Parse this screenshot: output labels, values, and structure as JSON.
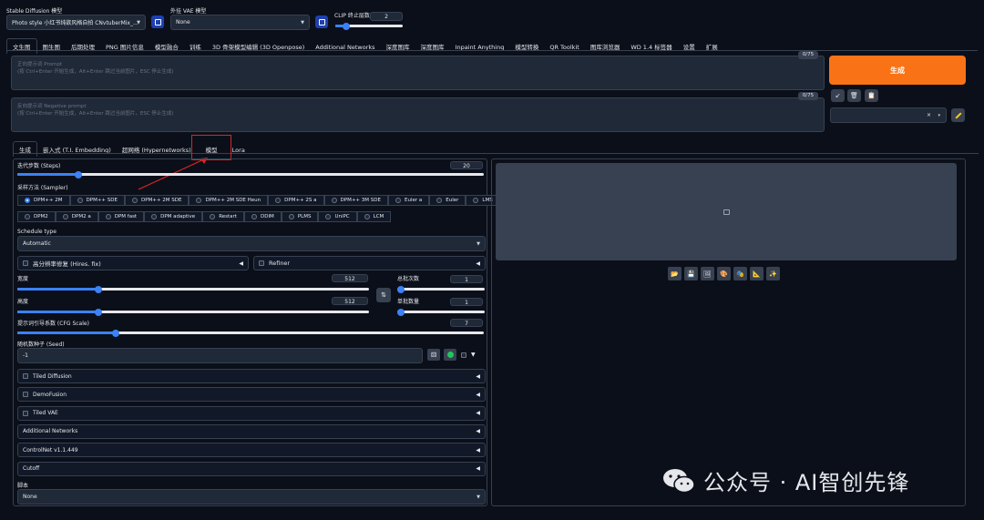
{
  "top": {
    "model_label": "Stable Diffusion 模型",
    "model_value": "Photo style 小红书纯欲风格自拍 CNvtuberMix_...",
    "vae_label": "外挂 VAE 模型",
    "vae_value": "None",
    "clip_label": "CLIP 终止层数",
    "clip_value": "2"
  },
  "main_tabs": [
    "文生图",
    "图生图",
    "后期处理",
    "PNG 图片信息",
    "模型融合",
    "训练",
    "3D 骨架模型编辑 (3D Openpose)",
    "Additional Networks",
    "深度图库",
    "深度图库",
    "Inpaint Anything",
    "模型转换",
    "QR Toolkit",
    "图库浏览器",
    "WD 1.4 标签器",
    "设置",
    "扩展"
  ],
  "prompt": {
    "placeholder_title": "正向提示词 Prompt",
    "placeholder_hint": "(按 Ctrl+Enter 开始生成，Alt+Enter 跳过当前图片，ESC 停止生成)",
    "count": "0/75"
  },
  "negative": {
    "placeholder_title": "反向提示词 Negative prompt",
    "placeholder_hint": "(按 Ctrl+Enter 开始生成，Alt+Enter 跳过当前图片，ESC 停止生成)",
    "count": "0/75"
  },
  "generate_label": "生成",
  "tool_icons": [
    "↙",
    "🗑",
    "📋"
  ],
  "style_select": {
    "clear": "×",
    "caret": "▾"
  },
  "sub_tabs": [
    "生成",
    "嵌入式 (T.I. Embedding)",
    "超网络 (Hypernetworks)",
    "模型",
    "Lora"
  ],
  "steps": {
    "label": "迭代步数 (Steps)",
    "value": "20",
    "fraction": 0.13
  },
  "sampler": {
    "label": "采样方法 (Sampler)",
    "row1": [
      "DPM++ 2M",
      "DPM++ SDE",
      "DPM++ 2M SDE",
      "DPM++ 2M SDE Heun",
      "DPM++ 2S a",
      "DPM++ 3M SDE",
      "Euler a",
      "Euler",
      "LMS",
      "Heun"
    ],
    "row2": [
      "DPM2",
      "DPM2 a",
      "DPM fast",
      "DPM adaptive",
      "Restart",
      "DDIM",
      "PLMS",
      "UniPC",
      "LCM"
    ],
    "selected": "DPM++ 2M"
  },
  "schedule": {
    "label": "Schedule type",
    "value": "Automatic"
  },
  "hires": {
    "label": "高分辨率修复 (Hires. fix)",
    "arrow": "◀"
  },
  "refiner": {
    "label": "Refiner",
    "arrow": "◀"
  },
  "width": {
    "label": "宽度",
    "value": "512",
    "fraction": 0.23
  },
  "height": {
    "label": "高度",
    "value": "512",
    "fraction": 0.23
  },
  "swap_icon": "⇅",
  "batch_count": {
    "label": "总批次数",
    "value": "1",
    "fraction": 0.0
  },
  "batch_size": {
    "label": "单批数量",
    "value": "1",
    "fraction": 0.0
  },
  "cfg": {
    "label": "提示词引导系数 (CFG Scale)",
    "value": "7",
    "fraction": 0.21
  },
  "seed": {
    "label": "随机数种子 (Seed)",
    "value": "-1",
    "more": "▼"
  },
  "accordions": [
    {
      "label": "Tiled Diffusion",
      "checkbox": true
    },
    {
      "label": "DemoFusion",
      "checkbox": true
    },
    {
      "label": "Tiled VAE",
      "checkbox": true
    },
    {
      "label": "Additional Networks",
      "checkbox": false
    },
    {
      "label": "ControlNet v1.1.449",
      "checkbox": false
    },
    {
      "label": "Cutoff",
      "checkbox": false
    }
  ],
  "accordion_arrow": "◀",
  "script": {
    "label": "脚本",
    "value": "None"
  },
  "gallery_buttons": [
    "📂",
    "💾",
    "🖼",
    "🎨",
    "🎭",
    "📐",
    "✨"
  ],
  "watermark": "公众号 · AI智创先锋",
  "colors": {
    "accent": "#f97316",
    "highlight": "#dc2626",
    "primary": "#3b82f6"
  }
}
